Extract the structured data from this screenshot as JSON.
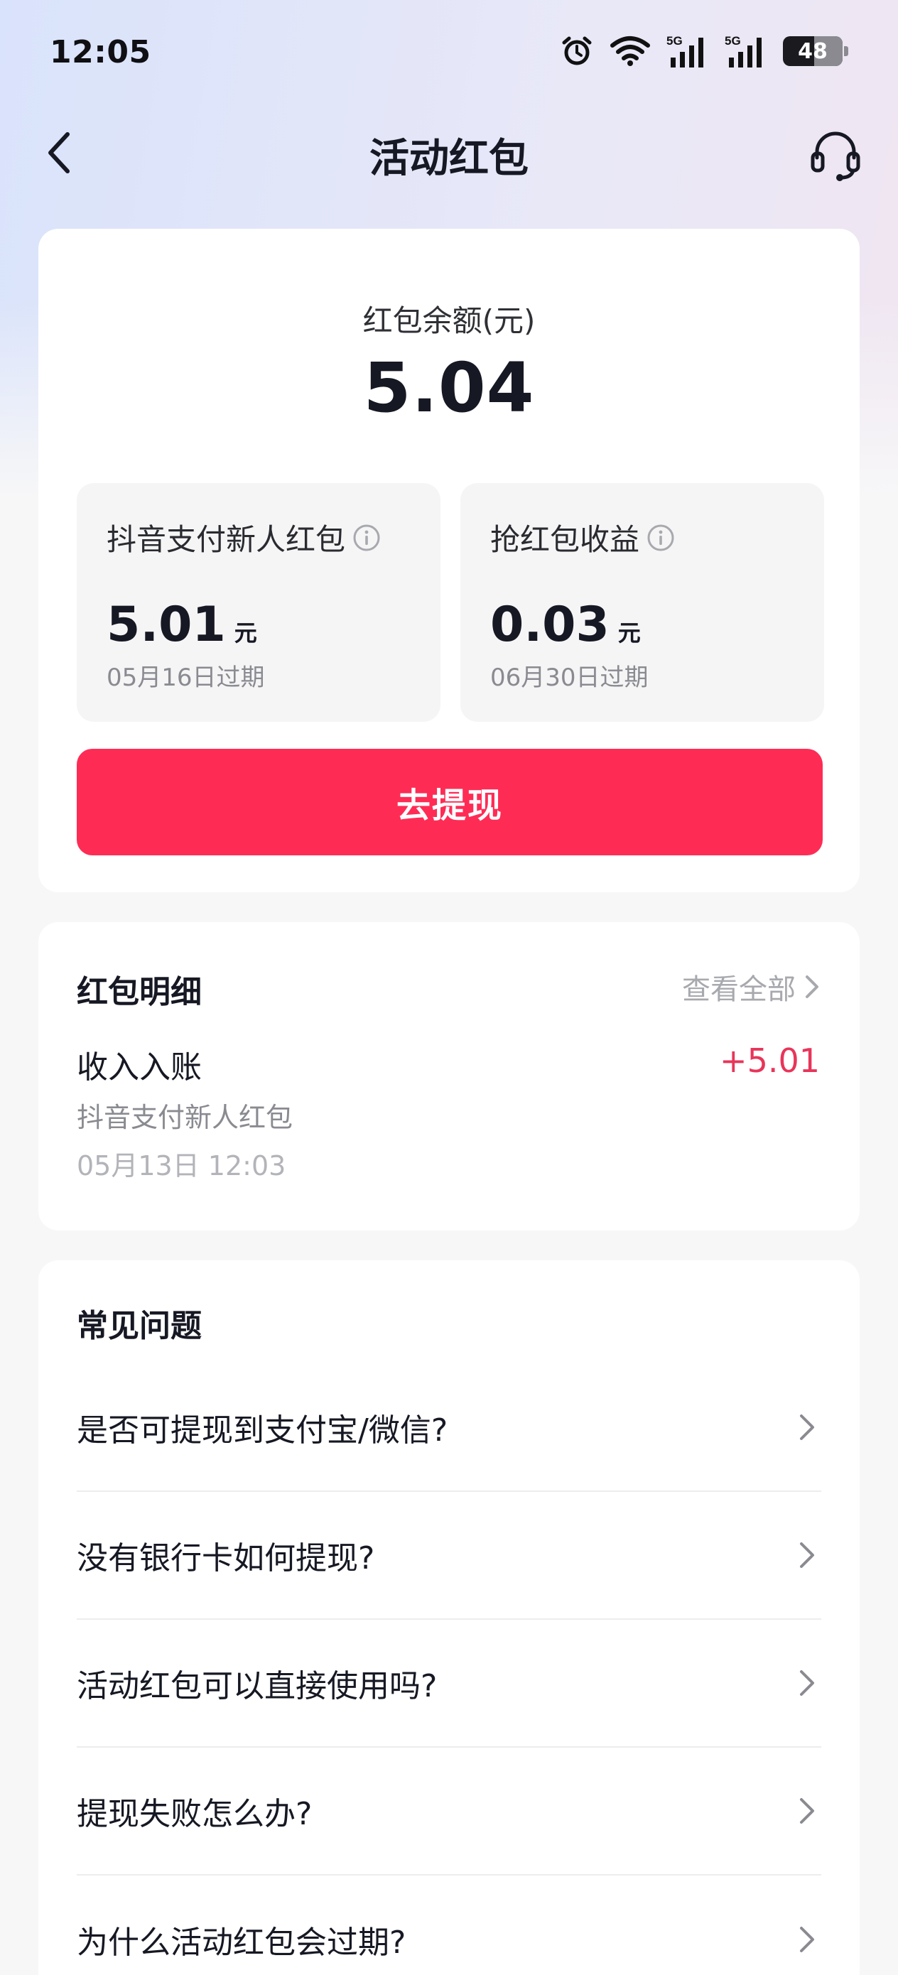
{
  "status_bar": {
    "time": "12:05",
    "battery": "48",
    "icons": [
      "alarm-icon",
      "wifi-icon",
      "signal-5g-icon",
      "signal-5g-icon",
      "battery-icon"
    ]
  },
  "nav": {
    "title": "活动红包",
    "back_icon": "chevron-left-icon",
    "support_icon": "headset-icon"
  },
  "balance": {
    "label": "红包余额(元)",
    "value": "5.04",
    "items": [
      {
        "title": "抖音支付新人红包",
        "amount": "5.01",
        "unit": "元",
        "expire": "05月16日过期"
      },
      {
        "title": "抢红包收益",
        "amount": "0.03",
        "unit": "元",
        "expire": "06月30日过期"
      }
    ],
    "withdraw_label": "去提现"
  },
  "detail": {
    "title": "红包明细",
    "view_all": "查看全部",
    "record": {
      "title": "收入入账",
      "amount": "+5.01",
      "source": "抖音支付新人红包",
      "time": "05月13日 12:03"
    }
  },
  "faq": {
    "title": "常见问题",
    "items": [
      "是否可提现到支付宝/微信?",
      "没有银行卡如何提现?",
      "活动红包可以直接使用吗?",
      "提现失败怎么办?",
      "为什么活动红包会过期?"
    ]
  },
  "colors": {
    "accent": "#fe2c55",
    "income": "#e8355a"
  }
}
